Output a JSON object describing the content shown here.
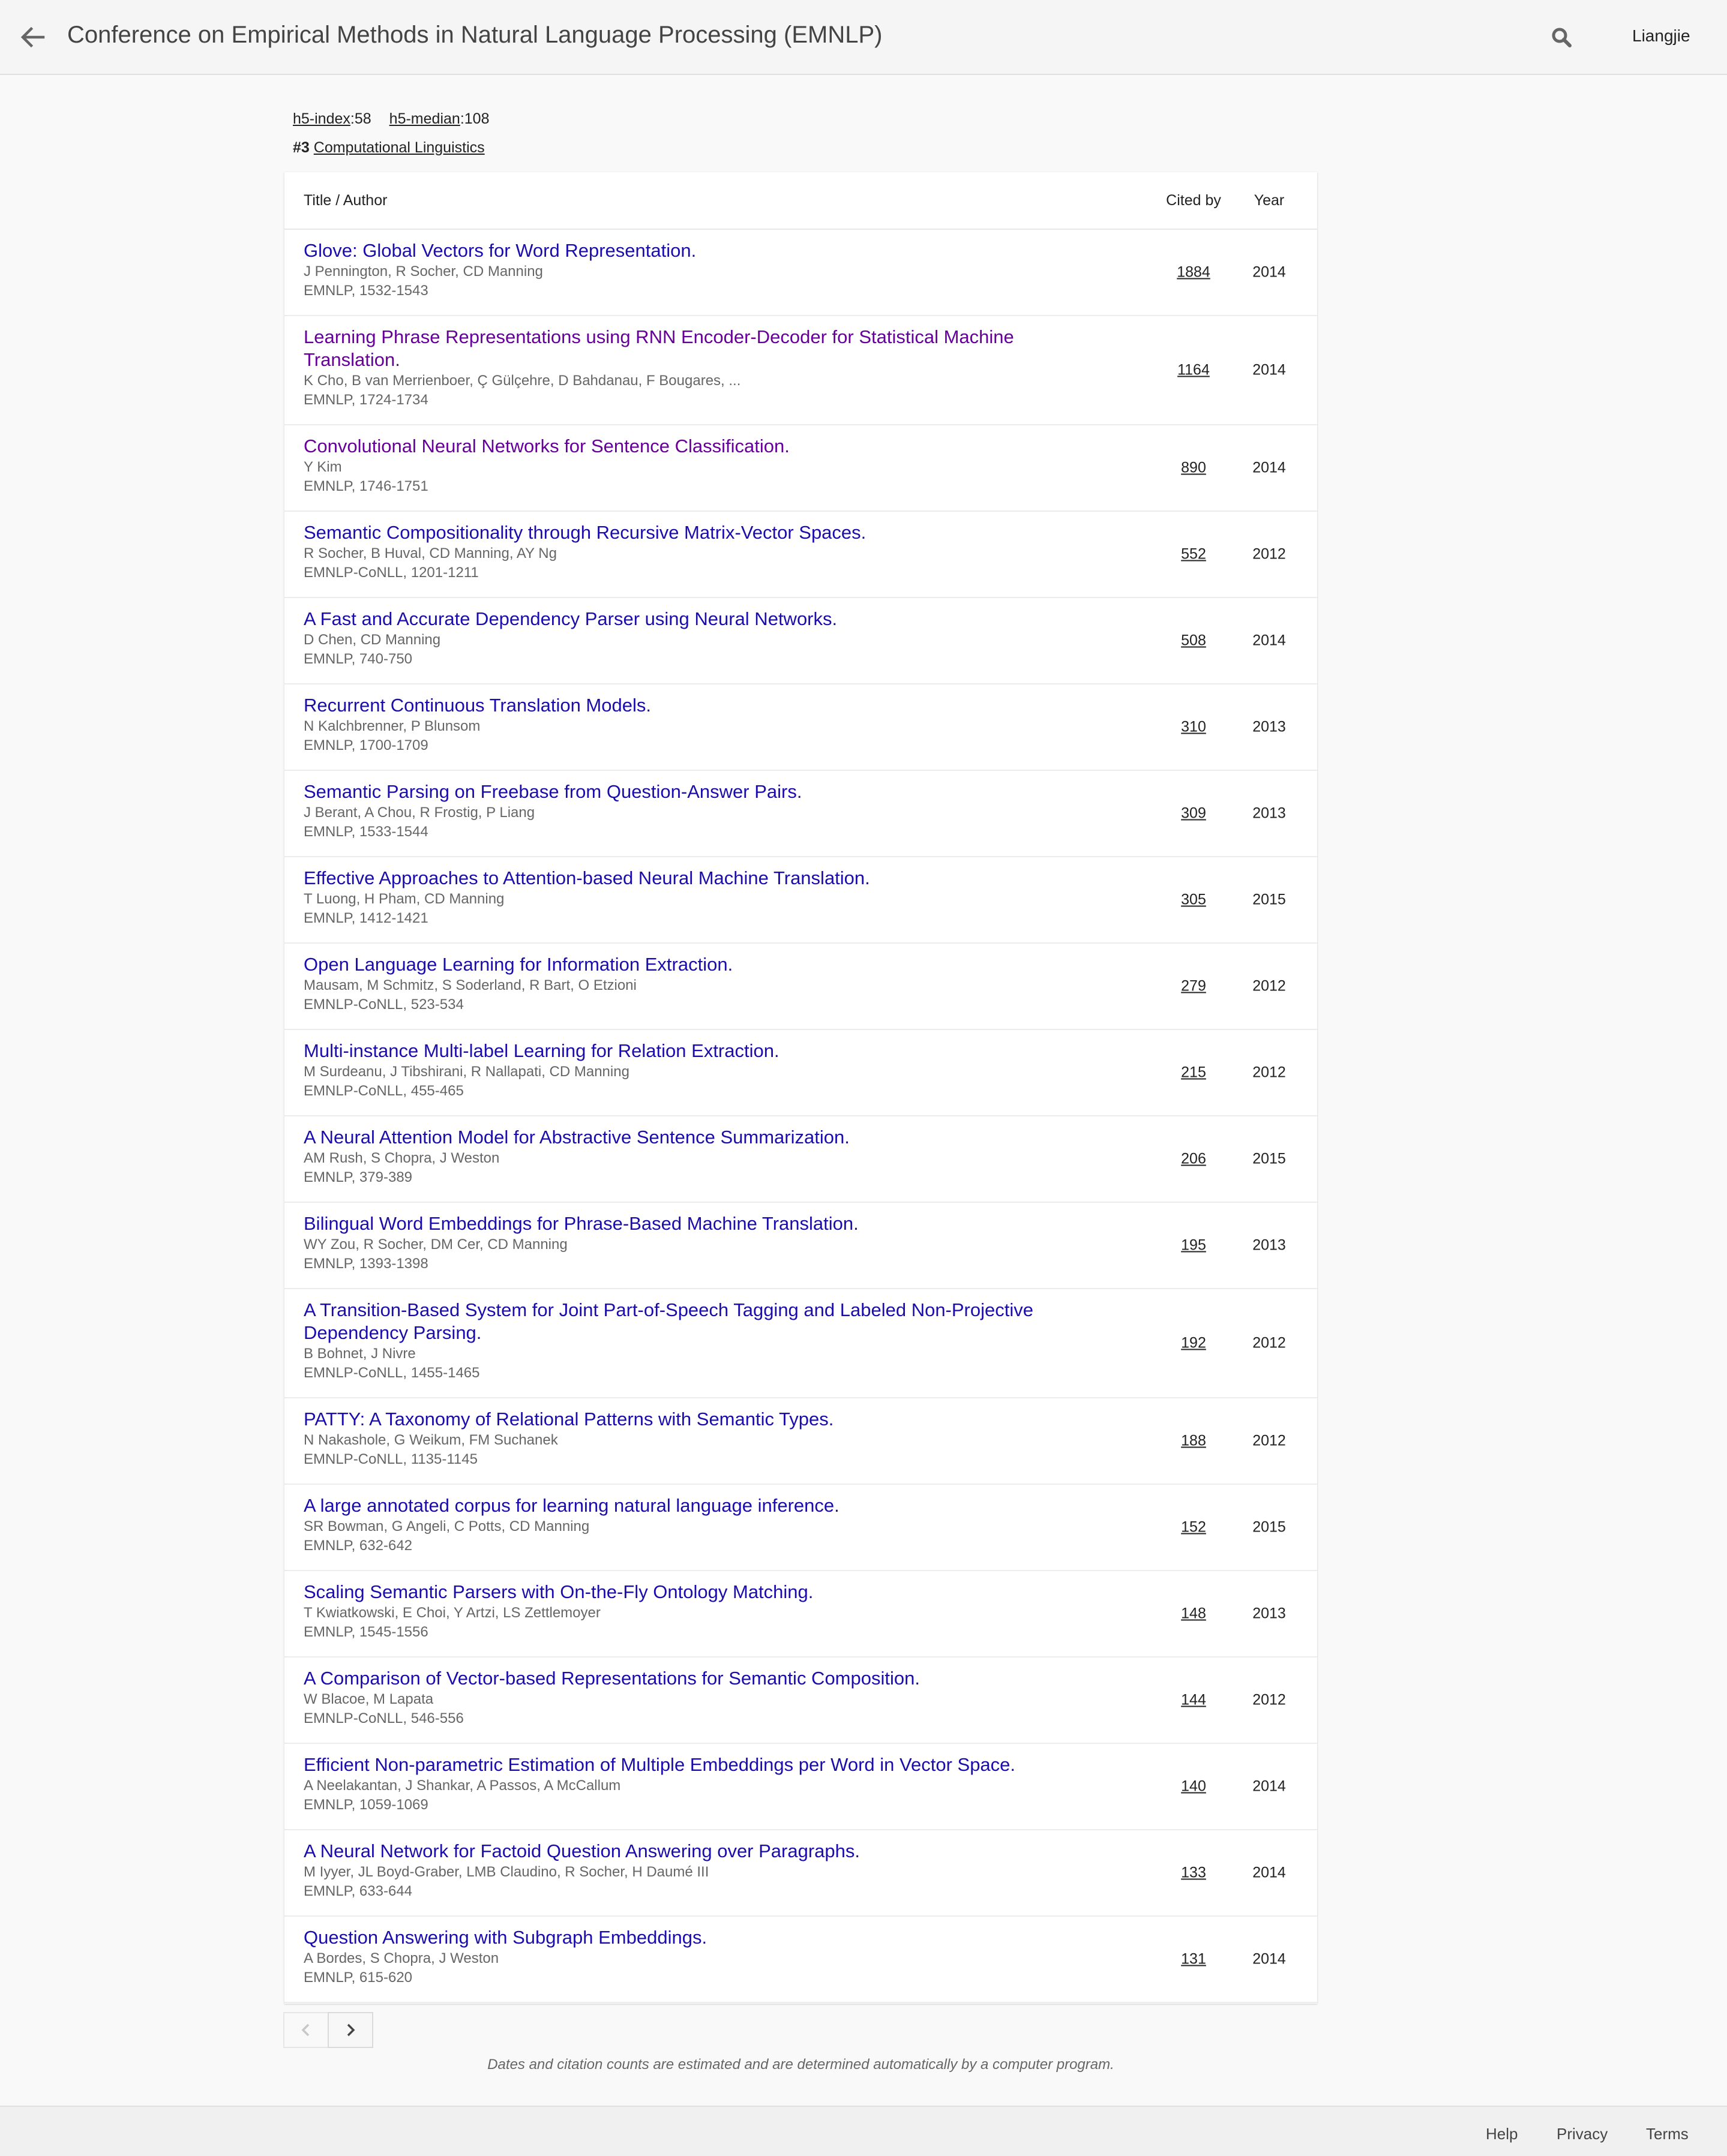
{
  "header": {
    "title": "Conference on Empirical Methods in Natural Language Processing (EMNLP)",
    "user": "Liangjie"
  },
  "metrics": {
    "h5_index_label": "h5-index",
    "h5_index_value": "58",
    "h5_median_label": "h5-median",
    "h5_median_value": "108",
    "rank": "#3",
    "category": "Computational Linguistics"
  },
  "table": {
    "col_title": "Title / Author",
    "col_cited": "Cited by",
    "col_year": "Year",
    "rows": [
      {
        "title": "Glove: Global Vectors for Word Representation.",
        "authors": "J Pennington, R Socher, CD Manning",
        "venue": "EMNLP, 1532-1543",
        "cited": "1884",
        "year": "2014"
      },
      {
        "title": "Learning Phrase Representations using RNN Encoder-Decoder for Statistical Machine Translation.",
        "authors": "K Cho, B van Merrienboer, Ç Gülçehre, D Bahdanau, F Bougares, ...",
        "venue": "EMNLP, 1724-1734",
        "cited": "1164",
        "year": "2014"
      },
      {
        "title": "Convolutional Neural Networks for Sentence Classification.",
        "authors": "Y Kim",
        "venue": "EMNLP, 1746-1751",
        "cited": "890",
        "year": "2014"
      },
      {
        "title": "Semantic Compositionality through Recursive Matrix-Vector Spaces.",
        "authors": "R Socher, B Huval, CD Manning, AY Ng",
        "venue": "EMNLP-CoNLL, 1201-1211",
        "cited": "552",
        "year": "2012"
      },
      {
        "title": "A Fast and Accurate Dependency Parser using Neural Networks.",
        "authors": "D Chen, CD Manning",
        "venue": "EMNLP, 740-750",
        "cited": "508",
        "year": "2014"
      },
      {
        "title": "Recurrent Continuous Translation Models.",
        "authors": "N Kalchbrenner, P Blunsom",
        "venue": "EMNLP, 1700-1709",
        "cited": "310",
        "year": "2013"
      },
      {
        "title": "Semantic Parsing on Freebase from Question-Answer Pairs.",
        "authors": "J Berant, A Chou, R Frostig, P Liang",
        "venue": "EMNLP, 1533-1544",
        "cited": "309",
        "year": "2013"
      },
      {
        "title": "Effective Approaches to Attention-based Neural Machine Translation.",
        "authors": "T Luong, H Pham, CD Manning",
        "venue": "EMNLP, 1412-1421",
        "cited": "305",
        "year": "2015"
      },
      {
        "title": "Open Language Learning for Information Extraction.",
        "authors": "Mausam, M Schmitz, S Soderland, R Bart, O Etzioni",
        "venue": "EMNLP-CoNLL, 523-534",
        "cited": "279",
        "year": "2012"
      },
      {
        "title": "Multi-instance Multi-label Learning for Relation Extraction.",
        "authors": "M Surdeanu, J Tibshirani, R Nallapati, CD Manning",
        "venue": "EMNLP-CoNLL, 455-465",
        "cited": "215",
        "year": "2012"
      },
      {
        "title": "A Neural Attention Model for Abstractive Sentence Summarization.",
        "authors": "AM Rush, S Chopra, J Weston",
        "venue": "EMNLP, 379-389",
        "cited": "206",
        "year": "2015"
      },
      {
        "title": "Bilingual Word Embeddings for Phrase-Based Machine Translation.",
        "authors": "WY Zou, R Socher, DM Cer, CD Manning",
        "venue": "EMNLP, 1393-1398",
        "cited": "195",
        "year": "2013"
      },
      {
        "title": "A Transition-Based System for Joint Part-of-Speech Tagging and Labeled Non-Projective Dependency Parsing.",
        "authors": "B Bohnet, J Nivre",
        "venue": "EMNLP-CoNLL, 1455-1465",
        "cited": "192",
        "year": "2012"
      },
      {
        "title": "PATTY: A Taxonomy of Relational Patterns with Semantic Types.",
        "authors": "N Nakashole, G Weikum, FM Suchanek",
        "venue": "EMNLP-CoNLL, 1135-1145",
        "cited": "188",
        "year": "2012"
      },
      {
        "title": "A large annotated corpus for learning natural language inference.",
        "authors": "SR Bowman, G Angeli, C Potts, CD Manning",
        "venue": "EMNLP, 632-642",
        "cited": "152",
        "year": "2015"
      },
      {
        "title": "Scaling Semantic Parsers with On-the-Fly Ontology Matching.",
        "authors": "T Kwiatkowski, E Choi, Y Artzi, LS Zettlemoyer",
        "venue": "EMNLP, 1545-1556",
        "cited": "148",
        "year": "2013"
      },
      {
        "title": "A Comparison of Vector-based Representations for Semantic Composition.",
        "authors": "W Blacoe, M Lapata",
        "venue": "EMNLP-CoNLL, 546-556",
        "cited": "144",
        "year": "2012"
      },
      {
        "title": "Efficient Non-parametric Estimation of Multiple Embeddings per Word in Vector Space.",
        "authors": "A Neelakantan, J Shankar, A Passos, A McCallum",
        "venue": "EMNLP, 1059-1069",
        "cited": "140",
        "year": "2014"
      },
      {
        "title": "A Neural Network for Factoid Question Answering over Paragraphs.",
        "authors": "M Iyyer, JL Boyd-Graber, LMB Claudino, R Socher, H Daumé III",
        "venue": "EMNLP, 633-644",
        "cited": "133",
        "year": "2014"
      },
      {
        "title": "Question Answering with Subgraph Embeddings.",
        "authors": "A Bordes, S Chopra, J Weston",
        "venue": "EMNLP, 615-620",
        "cited": "131",
        "year": "2014"
      }
    ]
  },
  "disclaimer": "Dates and citation counts are estimated and are determined automatically by a computer program.",
  "footer": {
    "help": "Help",
    "privacy": "Privacy",
    "terms": "Terms"
  },
  "colors": {
    "link": "#1a0dab",
    "visited_link": "#660099",
    "meta_text": "#666666"
  },
  "icons": [
    "back-arrow-icon",
    "search-icon",
    "chevron-left-icon",
    "chevron-right-icon"
  ]
}
